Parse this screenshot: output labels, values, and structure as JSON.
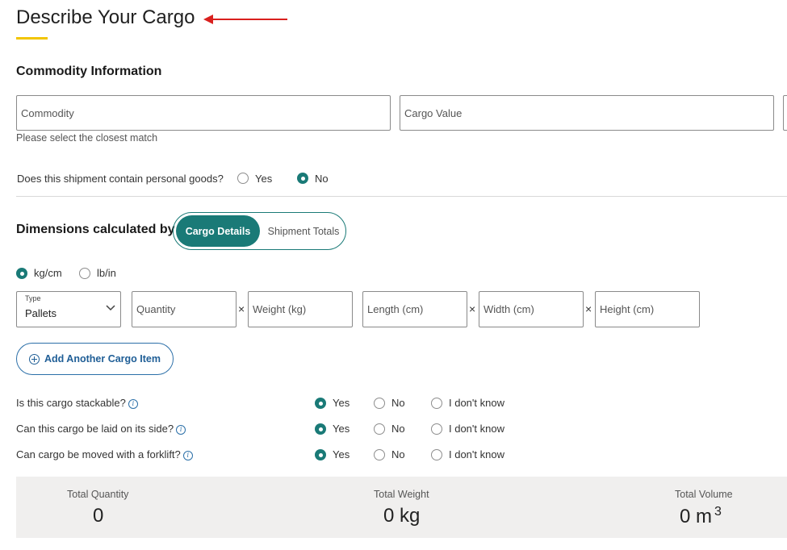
{
  "page": {
    "title": "Describe Your Cargo"
  },
  "commodity": {
    "heading": "Commodity Information",
    "commodity_placeholder": "Commodity",
    "cargo_value_placeholder": "Cargo Value",
    "hint": "Please select the closest match",
    "personal_goods_question": "Does this shipment contain personal goods?",
    "personal_goods_options": [
      "Yes",
      "No"
    ],
    "personal_goods_selected": "No"
  },
  "dimensions": {
    "heading": "Dimensions calculated by",
    "toggle_options": [
      "Cargo Details",
      "Shipment Totals"
    ],
    "toggle_selected": "Cargo Details",
    "units": [
      "kg/cm",
      "lb/in"
    ],
    "units_selected": "kg/cm"
  },
  "cargo_row": {
    "type_label": "Type",
    "type_value": "Pallets",
    "quantity_placeholder": "Quantity",
    "weight_placeholder": "Weight (kg)",
    "length_placeholder": "Length (cm)",
    "width_placeholder": "Width (cm)",
    "height_placeholder": "Height (cm)",
    "multiply_symbol": "×"
  },
  "add_item": {
    "label": "Add Another Cargo Item"
  },
  "questions": [
    {
      "text": "Is this cargo stackable?",
      "options": [
        "Yes",
        "No",
        "I don't know"
      ],
      "selected": "Yes"
    },
    {
      "text": "Can this cargo be laid on its side?",
      "options": [
        "Yes",
        "No",
        "I don't know"
      ],
      "selected": "Yes"
    },
    {
      "text": "Can cargo be moved with a forklift?",
      "options": [
        "Yes",
        "No",
        "I don't know"
      ],
      "selected": "Yes"
    }
  ],
  "totals": {
    "quantity_label": "Total Quantity",
    "quantity_value": "0",
    "weight_label": "Total Weight",
    "weight_value": "0 kg",
    "volume_label": "Total Volume",
    "volume_value": "0 m",
    "volume_sup": "3"
  },
  "colors": {
    "accent_teal": "#1a7a77",
    "accent_yellow": "#f2c500",
    "link_blue": "#1f5e96",
    "annotation_red": "#d9201e"
  },
  "icons": [
    "red-arrow-icon",
    "chevron-down-icon",
    "plus-circle-icon",
    "info-icon"
  ]
}
